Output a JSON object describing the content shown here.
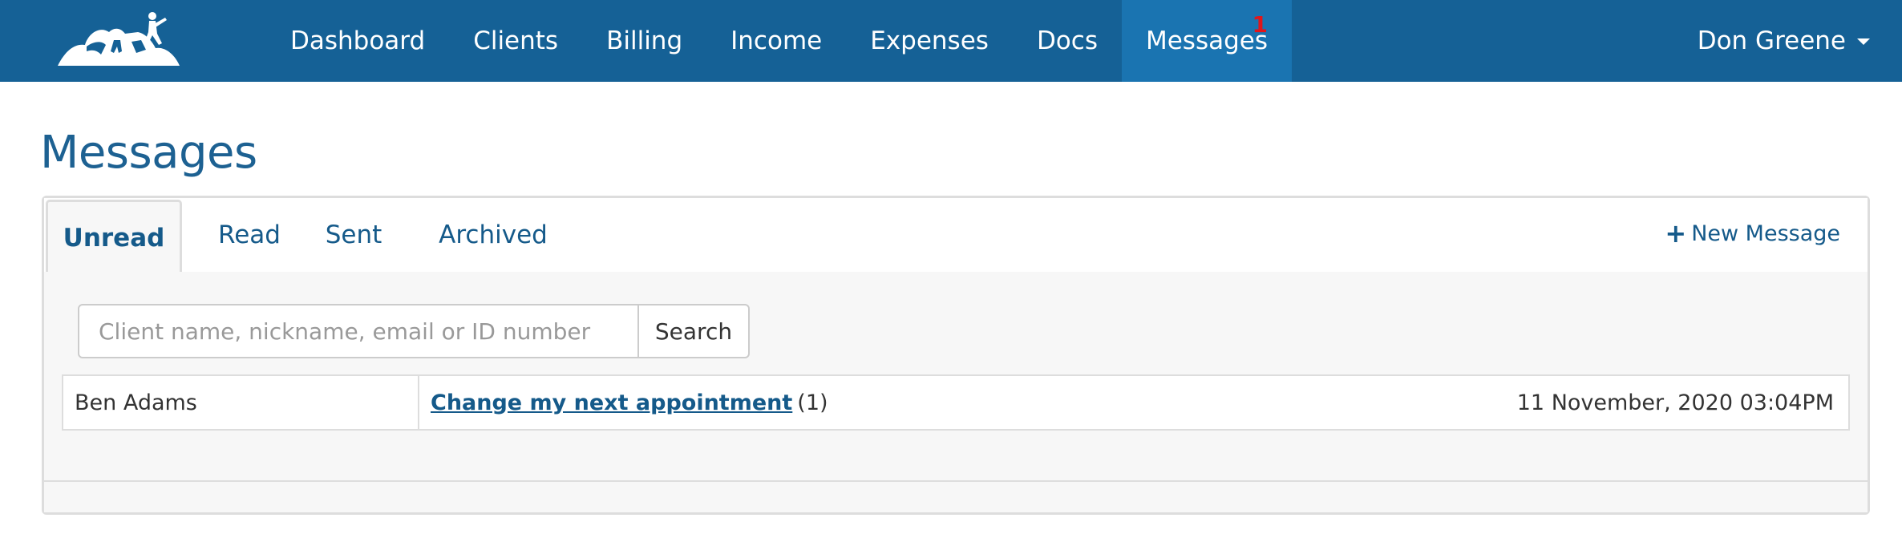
{
  "navbar": {
    "logo_icon": "climbers-logo-icon",
    "items": [
      {
        "label": "Dashboard"
      },
      {
        "label": "Clients"
      },
      {
        "label": "Billing"
      },
      {
        "label": "Income"
      },
      {
        "label": "Expenses"
      },
      {
        "label": "Docs"
      },
      {
        "label": "Messages",
        "badge": "1",
        "active": true
      }
    ],
    "user": {
      "name": "Don Greene"
    },
    "colors": {
      "background": "#156196",
      "active": "#1a74b1",
      "badge": "#e0161b"
    }
  },
  "page": {
    "title": "Messages"
  },
  "tabs": [
    {
      "label": "Unread",
      "active": true
    },
    {
      "label": "Read"
    },
    {
      "label": "Sent"
    },
    {
      "label": "Archived"
    }
  ],
  "new_message": {
    "label": "New Message"
  },
  "search": {
    "placeholder": "Client name, nickname, email or ID number",
    "value": "",
    "button_label": "Search"
  },
  "messages": [
    {
      "sender": "Ben Adams",
      "subject": "Change my next appointment",
      "count": "(1)",
      "date": "11 November, 2020 03:04PM"
    }
  ]
}
